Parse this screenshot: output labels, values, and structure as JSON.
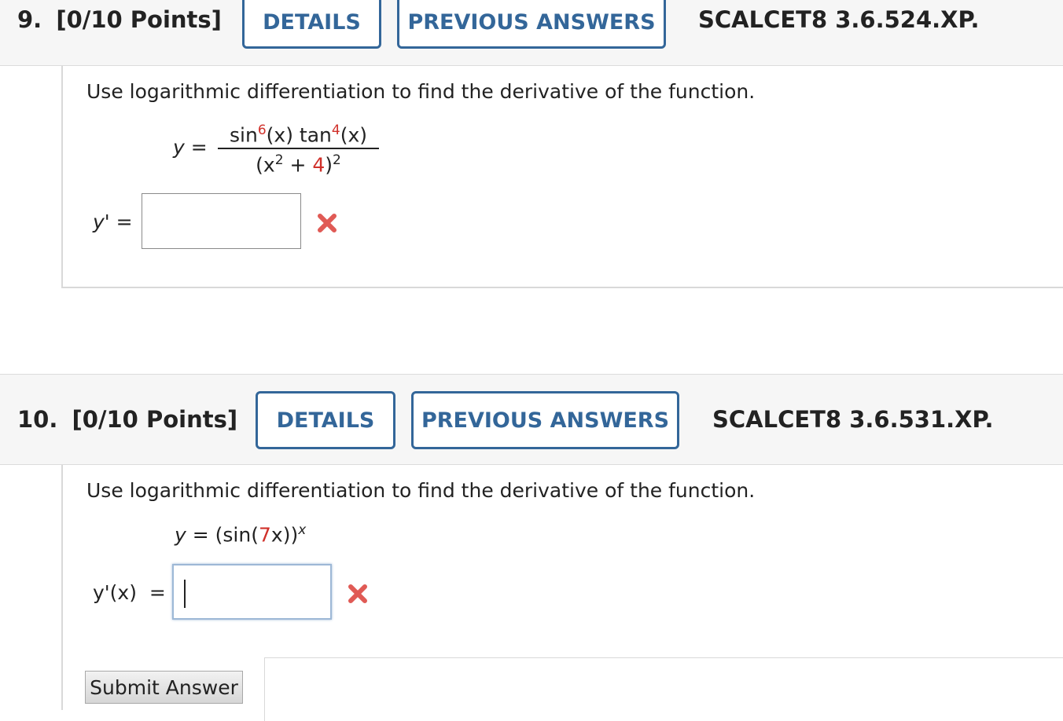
{
  "q9": {
    "number": "9.",
    "points": "[0/10 Points]",
    "details_label": "DETAILS",
    "previous_answers_label": "PREVIOUS ANSWERS",
    "ref": "SCALCET8 3.6.524.XP.",
    "prompt": "Use logarithmic differentiation to find the derivative of the function.",
    "eq_lhs": "y",
    "eq_equals": "=",
    "num_sin": "sin",
    "num_sin_exp": "6",
    "num_arg1": "(x)",
    "num_tan": "tan",
    "num_tan_exp": "4",
    "num_arg2": "(x)",
    "den_open": "(x",
    "den_sq": "2",
    "den_plus": "+",
    "den_const": "4",
    "den_close": ")",
    "den_exp": "2",
    "answer_label": "y' =",
    "answer_value": ""
  },
  "q10": {
    "number": "10.",
    "points": "[0/10 Points]",
    "details_label": "DETAILS",
    "previous_answers_label": "PREVIOUS ANSWERS",
    "ref": "SCALCET8 3.6.531.XP.",
    "prompt": "Use logarithmic differentiation to find the derivative of the function.",
    "eq_lhs": "y",
    "eq_equals": "=",
    "eq_open": "(sin(",
    "eq_coef": "7",
    "eq_var": "x",
    "eq_close": "))",
    "eq_exp": "x",
    "answer_label": "y'(x)  =",
    "answer_value": "",
    "submit_label": "Submit Answer"
  },
  "colors": {
    "accent": "#336699",
    "error": "#e05a55",
    "highlight": "#d0302a"
  }
}
